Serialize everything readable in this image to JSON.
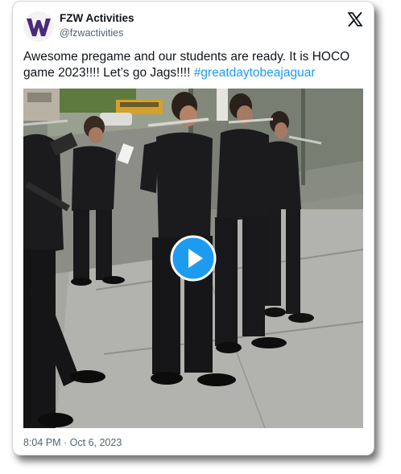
{
  "author": {
    "name": "FZW Activities",
    "handle": "@fzwactivities",
    "avatar_icon": "w-logo-icon",
    "brand_color": "#4b2a7b"
  },
  "platform_icon": "x-logo-icon",
  "post": {
    "text": "Awesome pregame and our students are ready. It is HOCO game 2023!!!!  Let’s go Jags!!!! ",
    "hashtag": "#greatdaytobeajaguar",
    "link_color": "#1d9bf0"
  },
  "media": {
    "type": "video",
    "play_icon": "play-icon",
    "play_color": "#1d9bf0"
  },
  "timestamp": "8:04 PM · Oct 6, 2023"
}
